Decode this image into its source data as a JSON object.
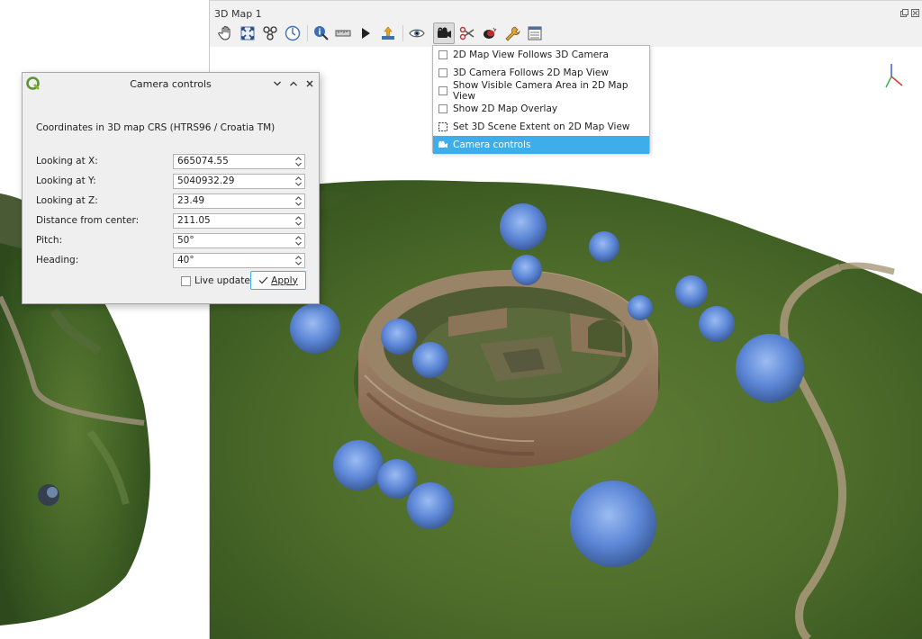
{
  "dock": {
    "title": "3D Map 1",
    "controls": [
      "float",
      "close"
    ]
  },
  "toolbar": {
    "buttons": [
      {
        "name": "pan-icon",
        "tooltip": ""
      },
      {
        "name": "zoom-full-icon"
      },
      {
        "name": "identify-3d-icon"
      },
      {
        "name": "measure-icon"
      },
      {
        "name": "info-icon"
      },
      {
        "name": "ruler-icon"
      },
      {
        "name": "play-animation-icon"
      },
      {
        "name": "export-scene-icon"
      },
      {
        "name": "eye-icon"
      },
      {
        "name": "camera-icon"
      },
      {
        "name": "scissors-icon"
      },
      {
        "name": "effects-icon"
      },
      {
        "name": "wrench-icon"
      },
      {
        "name": "panel-icon"
      }
    ]
  },
  "menu": {
    "items": [
      {
        "label": "2D Map View Follows 3D Camera",
        "type": "checkbox",
        "checked": false
      },
      {
        "label": "3D Camera Follows 2D Map View",
        "type": "checkbox",
        "checked": false
      },
      {
        "label": "Show Visible Camera Area in 2D Map View",
        "type": "checkbox",
        "checked": false
      },
      {
        "label": "Show 2D Map Overlay",
        "type": "checkbox",
        "checked": false
      },
      {
        "label": "Set 3D Scene Extent on 2D Map View",
        "type": "action",
        "icon": "extent-icon"
      },
      {
        "label": "Camera controls",
        "type": "action",
        "icon": "camera-icon",
        "selected": true
      }
    ]
  },
  "dialog": {
    "title": "Camera controls",
    "crs_label": "Coordinates in 3D map CRS (HTRS96 / Croatia TM)",
    "fields": [
      {
        "label": "Looking at X:",
        "value": "665074.55"
      },
      {
        "label": "Looking at Y:",
        "value": "5040932.29"
      },
      {
        "label": "Looking at Z:",
        "value": "23.49"
      },
      {
        "label": "Distance from center:",
        "value": "211.05"
      },
      {
        "label": "Pitch:",
        "value": "50°"
      },
      {
        "label": "Heading:",
        "value": "40°"
      }
    ],
    "live_update_label": "Live update",
    "live_update_checked": false,
    "apply_label": "Apply"
  },
  "colors": {
    "accent": "#3daee9",
    "selection": "#3daee9"
  }
}
